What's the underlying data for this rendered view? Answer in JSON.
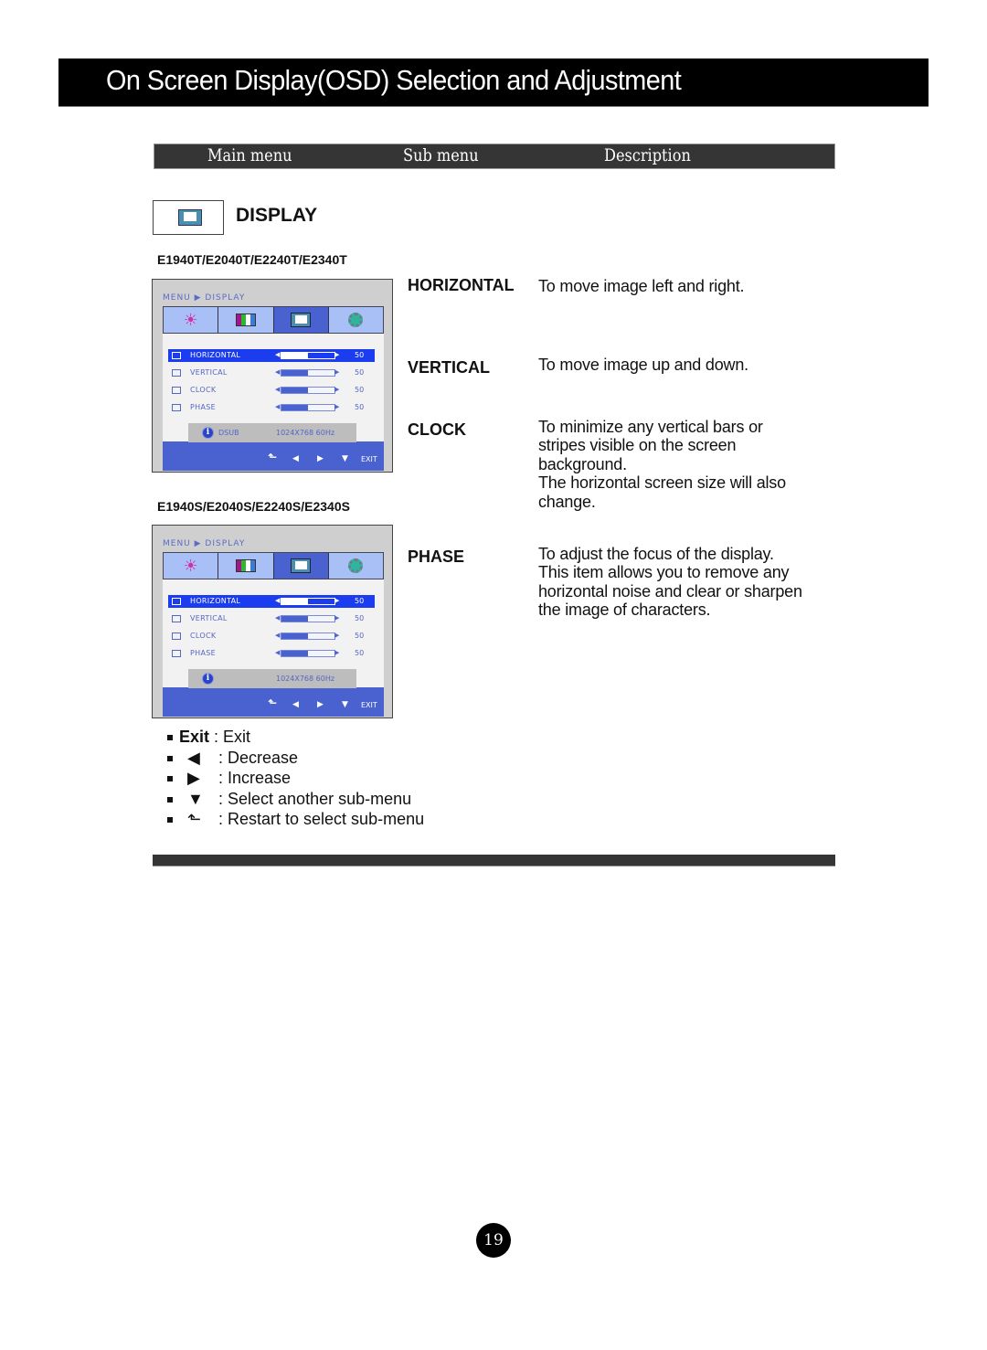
{
  "page": {
    "title": "On Screen Display(OSD) Selection and Adjustment",
    "page_number": "19"
  },
  "columns": {
    "main": "Main menu",
    "sub": "Sub menu",
    "description": "Description"
  },
  "section": {
    "icon": "display-icon",
    "label": "DISPLAY"
  },
  "osd_panels": [
    {
      "model": "E1940T/E2040T/E2240T/E2340T",
      "breadcrumb": "MENU ▶ DISPLAY",
      "tabs": [
        "brightness-icon",
        "color-icon",
        "display-icon",
        "setup-icon"
      ],
      "active_tab": 2,
      "rows": [
        {
          "label": "HORIZONTAL",
          "value": "50",
          "fraction": 0.5,
          "selected": true
        },
        {
          "label": "VERTICAL",
          "value": "50",
          "fraction": 0.5,
          "selected": false
        },
        {
          "label": "CLOCK",
          "value": "50",
          "fraction": 0.5,
          "selected": false
        },
        {
          "label": "PHASE",
          "value": "50",
          "fraction": 0.5,
          "selected": false
        }
      ],
      "info": {
        "source": "DSUB",
        "resolution": "1024X768  60Hz"
      },
      "footer": {
        "up": "⬑",
        "left": "◀",
        "right": "▶",
        "down": "▼",
        "exit": "EXIT"
      }
    },
    {
      "model": "E1940S/E2040S/E2240S/E2340S",
      "breadcrumb": "MENU ▶ DISPLAY",
      "tabs": [
        "brightness-icon",
        "color-icon",
        "display-icon",
        "setup-icon"
      ],
      "active_tab": 2,
      "rows": [
        {
          "label": "HORIZONTAL",
          "value": "50",
          "fraction": 0.5,
          "selected": true
        },
        {
          "label": "VERTICAL",
          "value": "50",
          "fraction": 0.5,
          "selected": false
        },
        {
          "label": "CLOCK",
          "value": "50",
          "fraction": 0.5,
          "selected": false
        },
        {
          "label": "PHASE",
          "value": "50",
          "fraction": 0.5,
          "selected": false
        }
      ],
      "info": {
        "source": "",
        "resolution": "1024X768  60Hz"
      },
      "footer": {
        "up": "⬑",
        "left": "◀",
        "right": "▶",
        "down": "▼",
        "exit": "EXIT"
      }
    }
  ],
  "submenus": [
    {
      "name": "HORIZONTAL",
      "description": [
        "To move image left and right."
      ]
    },
    {
      "name": "VERTICAL",
      "description": [
        "To move image up and down."
      ]
    },
    {
      "name": "CLOCK",
      "description": [
        "To minimize any vertical bars or",
        "stripes visible on the screen",
        "background.",
        "The horizontal screen size will also",
        "change."
      ]
    },
    {
      "name": "PHASE",
      "description": [
        "To adjust the focus of the display.",
        "This item allows you to remove any",
        "horizontal noise and clear or sharpen",
        "the image of characters."
      ]
    }
  ],
  "legend": {
    "exit_key": "Exit",
    "exit_text": ": Exit",
    "items": [
      {
        "icon": "left-triangle-icon",
        "glyph": "◀",
        "text": ": Decrease"
      },
      {
        "icon": "right-triangle-icon",
        "glyph": "▶",
        "text": ": Increase"
      },
      {
        "icon": "down-triangle-icon",
        "glyph": "▼",
        "text": ": Select another sub-menu"
      },
      {
        "icon": "return-arrow-icon",
        "glyph": "⬑",
        "text": ": Restart to select sub-menu"
      }
    ]
  }
}
